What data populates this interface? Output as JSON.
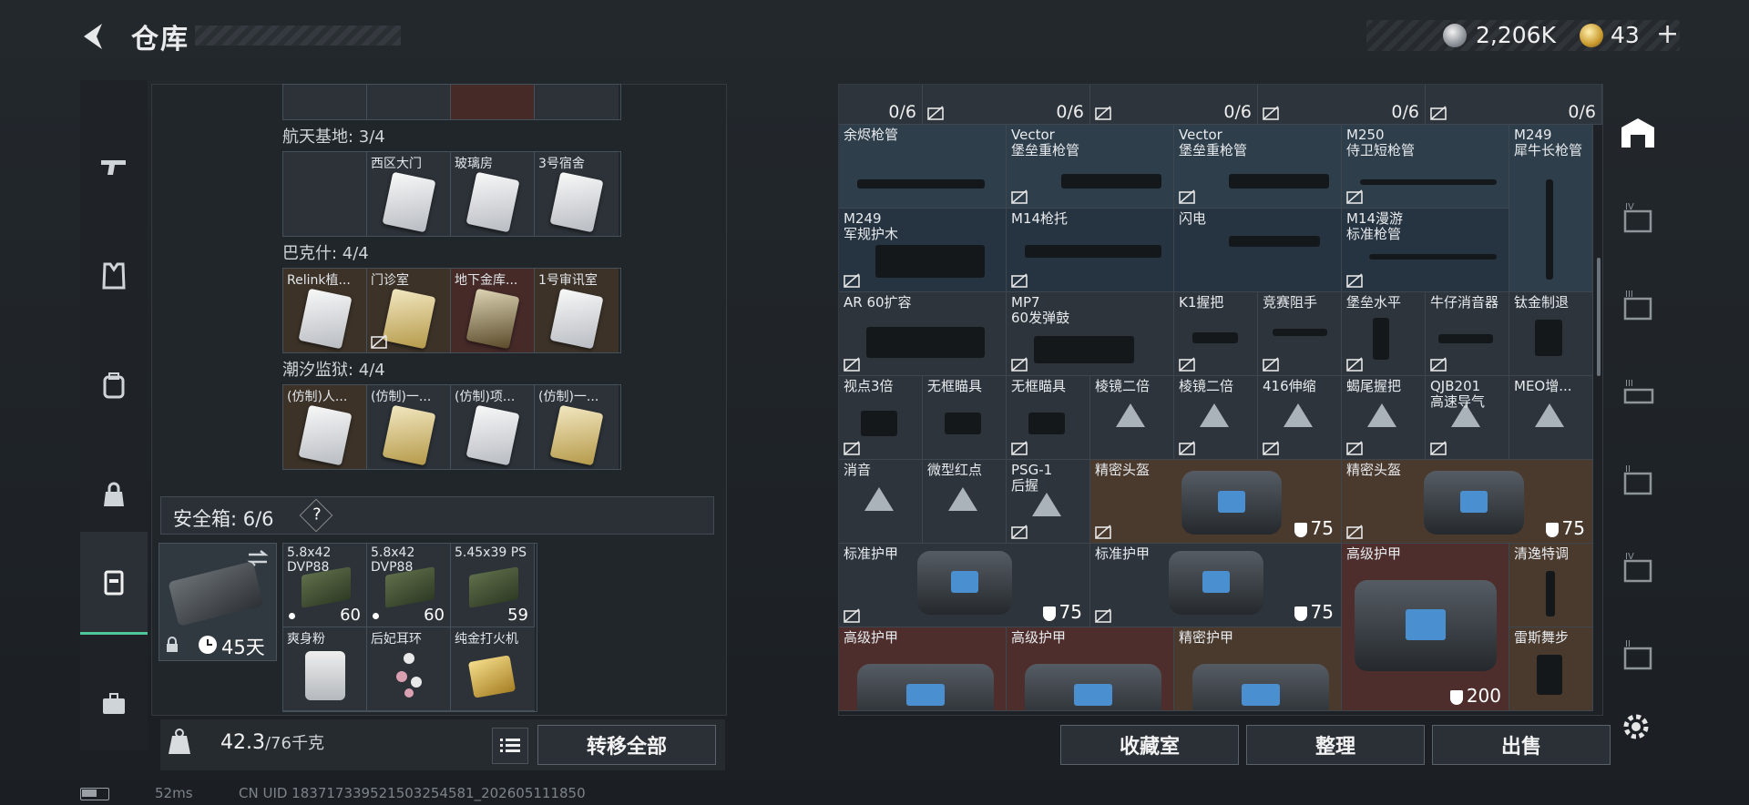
{
  "header": {
    "title": "仓库",
    "silver": "2,206K",
    "gold": "43",
    "plus": "+"
  },
  "left": {
    "sections": [
      {
        "title": "航天基地: 3/4",
        "slots": [
          {
            "label": "",
            "style": "gray",
            "card": "none"
          },
          {
            "label": "西区大门",
            "style": "gray",
            "card": "white"
          },
          {
            "label": "玻璃房",
            "style": "gray",
            "card": "white"
          },
          {
            "label": "3号宿舍",
            "style": "gray",
            "card": "white"
          }
        ]
      },
      {
        "title": "巴克什: 4/4",
        "slots": [
          {
            "label": "Relink植...",
            "style": "brown",
            "card": "white"
          },
          {
            "label": "门诊室",
            "style": "brown",
            "card": "gold"
          },
          {
            "label": "地下金库...",
            "style": "red",
            "card": "dark"
          },
          {
            "label": "1号审讯室",
            "style": "brown",
            "card": "white"
          }
        ]
      },
      {
        "title": "潮汐监狱: 4/4",
        "slots": [
          {
            "label": "(仿制)人...",
            "style": "brown",
            "card": "white"
          },
          {
            "label": "(仿制)一...",
            "style": "gray",
            "card": "gold"
          },
          {
            "label": "(仿制)项...",
            "style": "gray",
            "card": "white"
          },
          {
            "label": "(仿制)一...",
            "style": "gray",
            "card": "gold"
          }
        ]
      }
    ],
    "safe": {
      "title": "安全箱: 6/6",
      "help": "?",
      "timer": "45天",
      "items": [
        {
          "label": "5.8x42 DVP88",
          "count": "60",
          "dot": true,
          "kind": "ammo"
        },
        {
          "label": "5.8x42 DVP88",
          "count": "60",
          "dot": true,
          "kind": "ammo"
        },
        {
          "label": "5.45x39 PS",
          "count": "59",
          "dot": false,
          "kind": "ammo"
        },
        {
          "label": "爽身粉",
          "count": "",
          "dot": false,
          "kind": "can"
        },
        {
          "label": "后妃耳环",
          "count": "",
          "dot": false,
          "kind": "earring"
        },
        {
          "label": "纯金打火机",
          "count": "",
          "dot": false,
          "kind": "lighter"
        }
      ]
    },
    "weight": {
      "value": "42.3",
      "max": "/76千克"
    },
    "transfer_all": "转移全部"
  },
  "grid": {
    "top_counts": [
      "0/6",
      "0/6",
      "0/6",
      "0/6",
      "0/6"
    ],
    "cells": [
      {
        "label": "余烬枪管"
      },
      {
        "label": "Vector\n堡垒重枪管"
      },
      {
        "label": "Vector\n堡垒重枪管"
      },
      {
        "label": "M250\n侍卫短枪管"
      },
      {
        "label": "M249\n犀牛长枪管"
      },
      {
        "label": "M249\n军规护木"
      },
      {
        "label": "M14枪托"
      },
      {
        "label": "闪电"
      },
      {
        "label": "M14漫游\n标准枪管"
      },
      {
        "label": "AR 60扩容"
      },
      {
        "label": "MP7\n60发弹鼓"
      },
      {
        "label": "K1握把"
      },
      {
        "label": "竞赛阻手"
      },
      {
        "label": "堡垒水平"
      },
      {
        "label": "牛仔消音器"
      },
      {
        "label": "钛金制退"
      },
      {
        "label": "视点3倍"
      },
      {
        "label": "无框瞄具"
      },
      {
        "label": "无框瞄具"
      },
      {
        "label": "棱镜二倍"
      },
      {
        "label": "棱镜二倍"
      },
      {
        "label": "416伸缩"
      },
      {
        "label": "蝎尾握把"
      },
      {
        "label": "QJB201\n高速导气"
      },
      {
        "label": "MEO增..."
      },
      {
        "label": "消音"
      },
      {
        "label": "微型红点"
      },
      {
        "label": "PSG-1\n后握"
      },
      {
        "label": "精密头盔",
        "value": "75"
      },
      {
        "label": "精密头盔",
        "value": "75"
      },
      {
        "label": "标准护甲",
        "value": "75"
      },
      {
        "label": "标准护甲",
        "value": "75"
      },
      {
        "label": "高级护甲",
        "value": "200"
      },
      {
        "label": "清逸特调"
      },
      {
        "label": "雷斯舞步"
      },
      {
        "label": "高级护甲"
      },
      {
        "label": "高级护甲"
      },
      {
        "label": "精密护甲"
      }
    ],
    "buttons": {
      "collection": "收藏室",
      "sort": "整理",
      "sell": "出售"
    }
  },
  "footer": {
    "ping": "52ms",
    "uid": "CN UID 183717339521503254581_202605111850"
  },
  "colors": {
    "accent": "#4fc79a",
    "armor_red": "#4e2e2c",
    "helmet_brown": "#4a3a2e"
  }
}
